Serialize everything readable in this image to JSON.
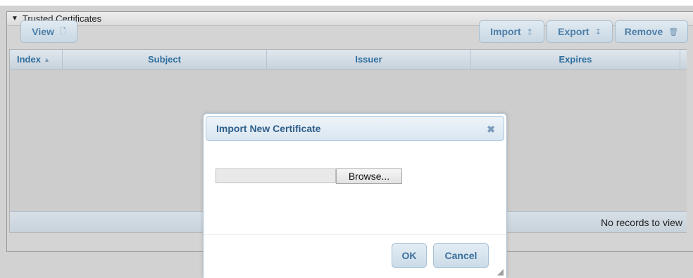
{
  "panel": {
    "title": "Trusted Certificates",
    "caret_icon": "triangle-down-icon"
  },
  "toolbar": {
    "view_label": "View",
    "view_icon": "document-icon",
    "import_label": "Import",
    "import_icon": "upload-icon",
    "export_label": "Export",
    "export_icon": "download-icon",
    "remove_label": "Remove",
    "remove_icon": "trash-icon"
  },
  "grid": {
    "columns": [
      "Index",
      "Subject",
      "Issuer",
      "Expires"
    ],
    "empty_text": "No records to view"
  },
  "modal": {
    "title": "Import New Certificate",
    "file_input_value": "",
    "browse_label": "Browse...",
    "ok_label": "OK",
    "cancel_label": "Cancel"
  }
}
